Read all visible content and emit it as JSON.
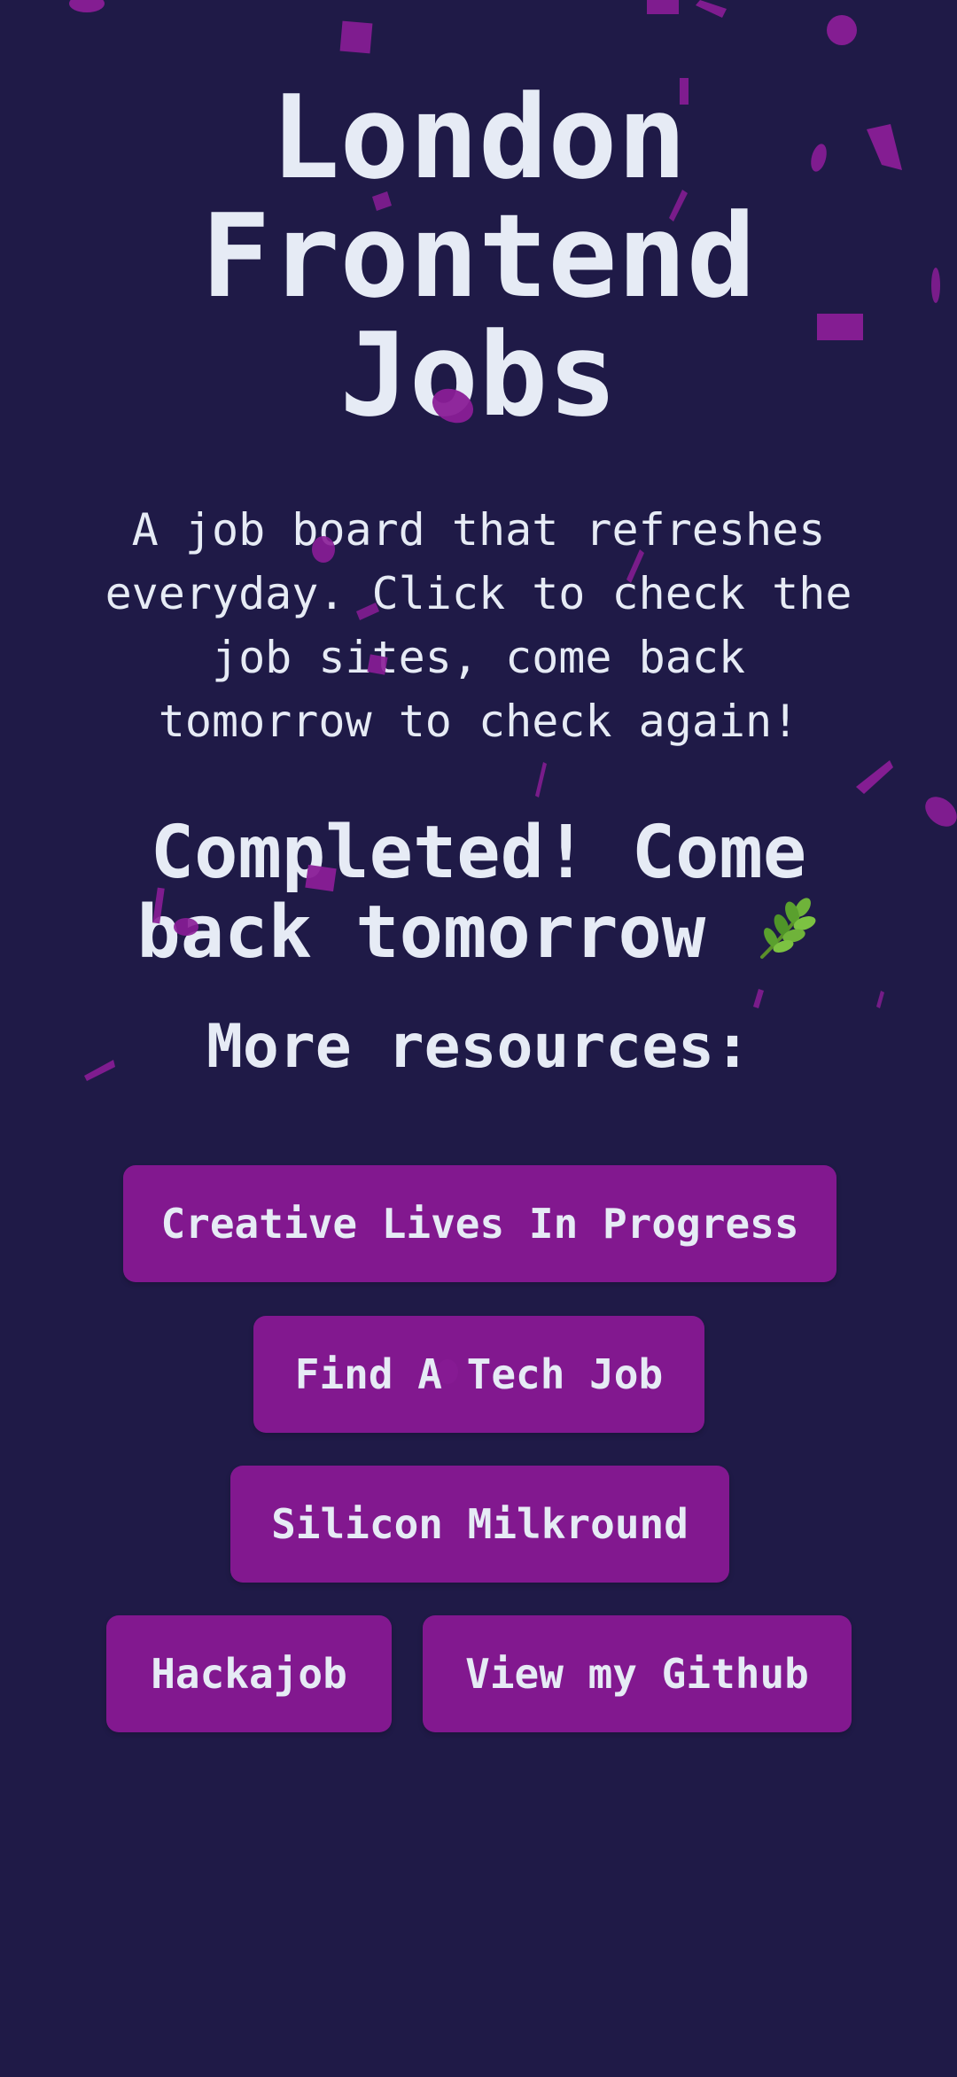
{
  "header": {
    "title_line1": "London",
    "title_line2": "Frontend",
    "title_line3": "Jobs"
  },
  "description": "A job board that refreshes everyday. Click to check the job sites, come back tomorrow to check again!",
  "status": {
    "text": "Completed! Come back tomorrow",
    "emoji": "herb-icon"
  },
  "resources": {
    "heading": "More resources:",
    "links": [
      {
        "label": "Creative Lives In Progress"
      },
      {
        "label": "Find A Tech Job"
      },
      {
        "label": "Silicon Milkround"
      },
      {
        "label": "Hackajob"
      },
      {
        "label": "View my Github"
      }
    ]
  },
  "colors": {
    "background": "#1f1a47",
    "text": "#e6ebf5",
    "button": "#82188f",
    "confetti": "#8a1d97"
  }
}
